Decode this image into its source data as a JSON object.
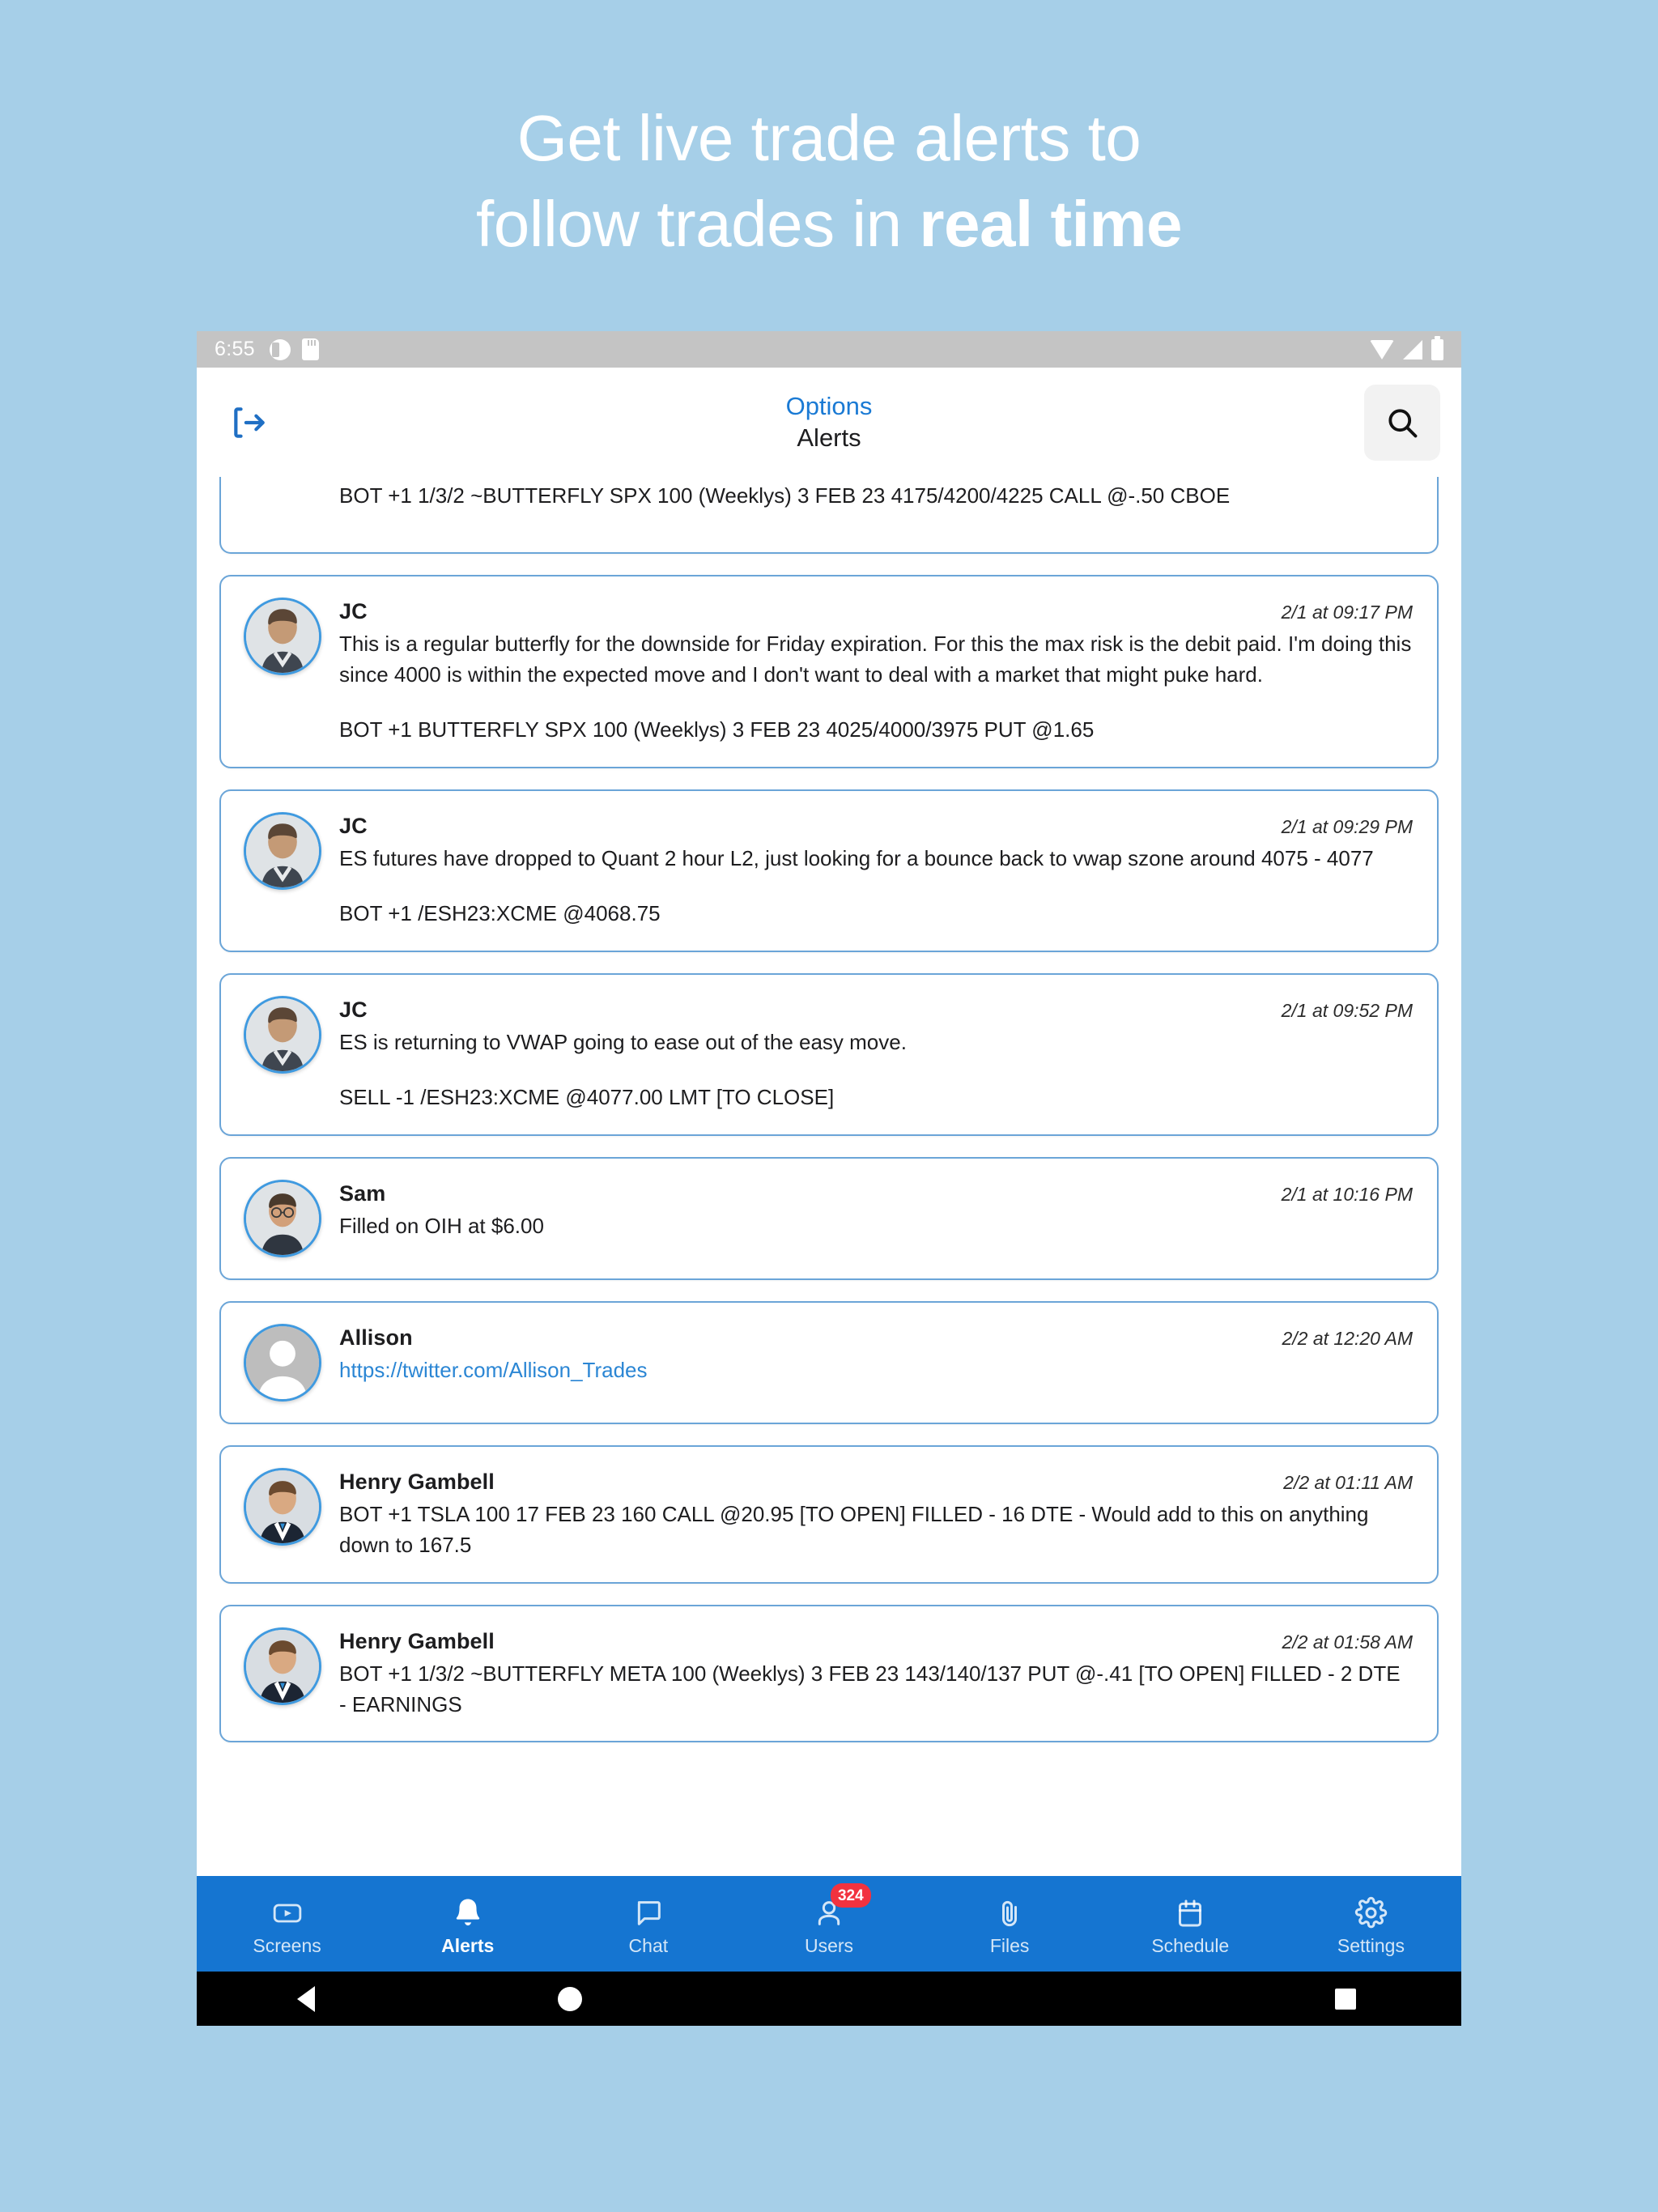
{
  "headline": {
    "line1": "Get live trade alerts to",
    "line2_normal": "follow trades in ",
    "line2_bold": "real time"
  },
  "statusbar": {
    "time": "6:55",
    "left_icons": [
      "notification-circle-icon",
      "sd-card-icon"
    ],
    "right_icons": [
      "wifi-icon",
      "cell-signal-icon",
      "battery-icon"
    ]
  },
  "appbar": {
    "logout_icon": "logout-icon",
    "title_primary": "Options",
    "title_secondary": "Alerts",
    "search_icon": "search-icon"
  },
  "feed": {
    "clipped_card": {
      "text": "BOT +1 1/3/2 ~BUTTERFLY SPX 100 (Weeklys) 3 FEB 23 4175/4200/4225 CALL @-.50 CBOE"
    },
    "cards": [
      {
        "author": "JC",
        "timestamp": "2/1 at 09:17 PM",
        "avatar": "photo",
        "lines": [
          "This is a regular butterfly for the downside for Friday expiration.  For this the max risk is the debit paid.  I'm doing this since 4000 is within the expected move and I don't want to deal with a market that might puke hard.",
          "BOT +1 BUTTERFLY SPX 100 (Weeklys) 3 FEB 23 4025/4000/3975 PUT @1.65"
        ]
      },
      {
        "author": "JC",
        "timestamp": "2/1 at 09:29 PM",
        "avatar": "photo",
        "lines": [
          "ES futures have dropped to Quant 2 hour L2, just looking for a bounce back to vwap szone around 4075 - 4077",
          "BOT +1 /ESH23:XCME @4068.75"
        ]
      },
      {
        "author": "JC",
        "timestamp": "2/1 at 09:52 PM",
        "avatar": "photo",
        "lines": [
          "ES is returning to VWAP going to ease out of the easy move.",
          "SELL -1 /ESH23:XCME @4077.00 LMT [TO CLOSE]"
        ]
      },
      {
        "author": "Sam",
        "timestamp": "2/1 at 10:16 PM",
        "avatar": "photo",
        "lines": [
          "Filled on OIH at $6.00"
        ]
      },
      {
        "author": "Allison",
        "timestamp": "2/2 at 12:20 AM",
        "avatar": "placeholder",
        "link": "https://twitter.com/Allison_Trades",
        "lines": []
      },
      {
        "author": "Henry Gambell",
        "timestamp": "2/2 at 01:11 AM",
        "avatar": "photo",
        "lines": [
          "BOT +1 TSLA 100 17 FEB 23 160 CALL @20.95 [TO OPEN] FILLED - 16 DTE - Would add to this on anything down to 167.5"
        ]
      },
      {
        "author": "Henry Gambell",
        "timestamp": "2/2 at 01:58 AM",
        "avatar": "photo",
        "lines": [
          "BOT +1 1/3/2 ~BUTTERFLY META 100 (Weeklys) 3 FEB 23 143/140/137 PUT @-.41 [TO OPEN] FILLED - 2 DTE - EARNINGS"
        ]
      }
    ]
  },
  "tabbar": {
    "items": [
      {
        "label": "Screens",
        "icon": "screens-icon",
        "active": false,
        "badge": null
      },
      {
        "label": "Alerts",
        "icon": "bell-icon",
        "active": true,
        "badge": null
      },
      {
        "label": "Chat",
        "icon": "chat-icon",
        "active": false,
        "badge": null
      },
      {
        "label": "Users",
        "icon": "users-icon",
        "active": false,
        "badge": "324"
      },
      {
        "label": "Files",
        "icon": "paperclip-icon",
        "active": false,
        "badge": null
      },
      {
        "label": "Schedule",
        "icon": "calendar-icon",
        "active": false,
        "badge": null
      },
      {
        "label": "Settings",
        "icon": "gear-icon",
        "active": false,
        "badge": null
      }
    ]
  },
  "androidnav": {
    "back_icon": "android-back-icon",
    "home_icon": "android-home-icon",
    "recents_icon": "android-recents-icon"
  },
  "colors": {
    "page_background": "#a6cfe8",
    "accent_blue": "#1575d1",
    "link_blue": "#2b86d4",
    "card_border": "#6ba5d8",
    "badge_red": "#f2323f"
  }
}
